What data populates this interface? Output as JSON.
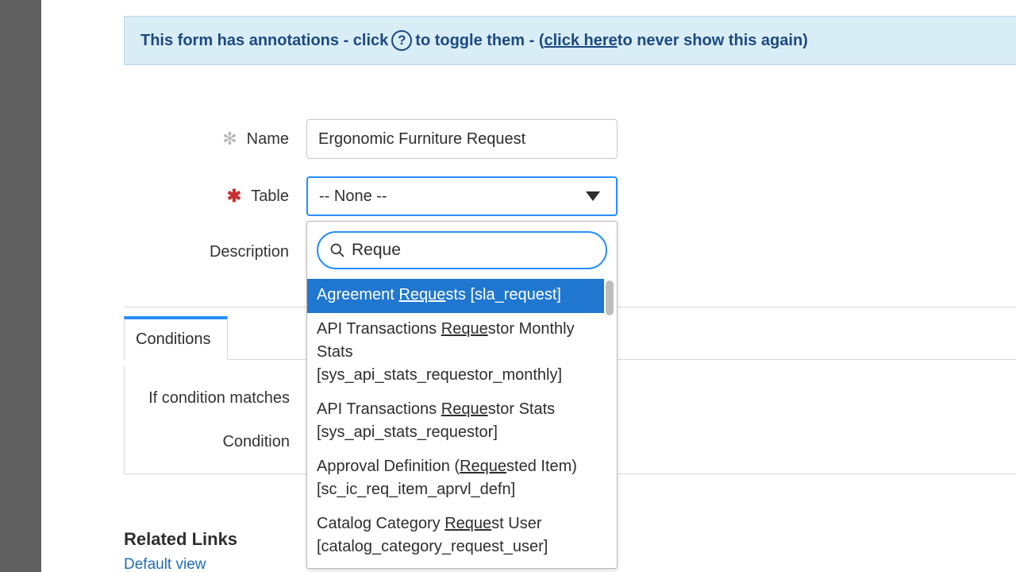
{
  "banner": {
    "pre": "This form has annotations - click ",
    "mid": " to toggle them - (",
    "link": "click here",
    "post": " to never show this again)"
  },
  "fields": {
    "name": {
      "label": "Name",
      "value": "Ergonomic Furniture Request"
    },
    "table": {
      "label": "Table",
      "value": "-- None --"
    },
    "description": {
      "label": "Description"
    }
  },
  "dropdown": {
    "search": "Reque",
    "match": "Reque",
    "options": [
      {
        "pre": "Agreement ",
        "mid": "Reque",
        "post": "sts [sla_request]",
        "highlight": true
      },
      {
        "pre": "API Transactions ",
        "mid": "Reque",
        "post": "stor Monthly Stats [sys_api_stats_requestor_monthly]"
      },
      {
        "pre": "API Transactions ",
        "mid": "Reque",
        "post": "stor Stats [sys_api_stats_requestor]"
      },
      {
        "pre": "Approval Definition (",
        "mid": "Reque",
        "post": "sted Item) [sc_ic_req_item_aprvl_defn]"
      },
      {
        "pre": "Catalog Category ",
        "mid": "Reque",
        "post": "st User [catalog_category_request_user]"
      }
    ]
  },
  "tabs": {
    "conditions": "Conditions"
  },
  "conditions": {
    "ifMatches": "If condition matches",
    "condition": "Condition"
  },
  "related": {
    "heading": "Related Links",
    "defaultView": "Default view"
  }
}
